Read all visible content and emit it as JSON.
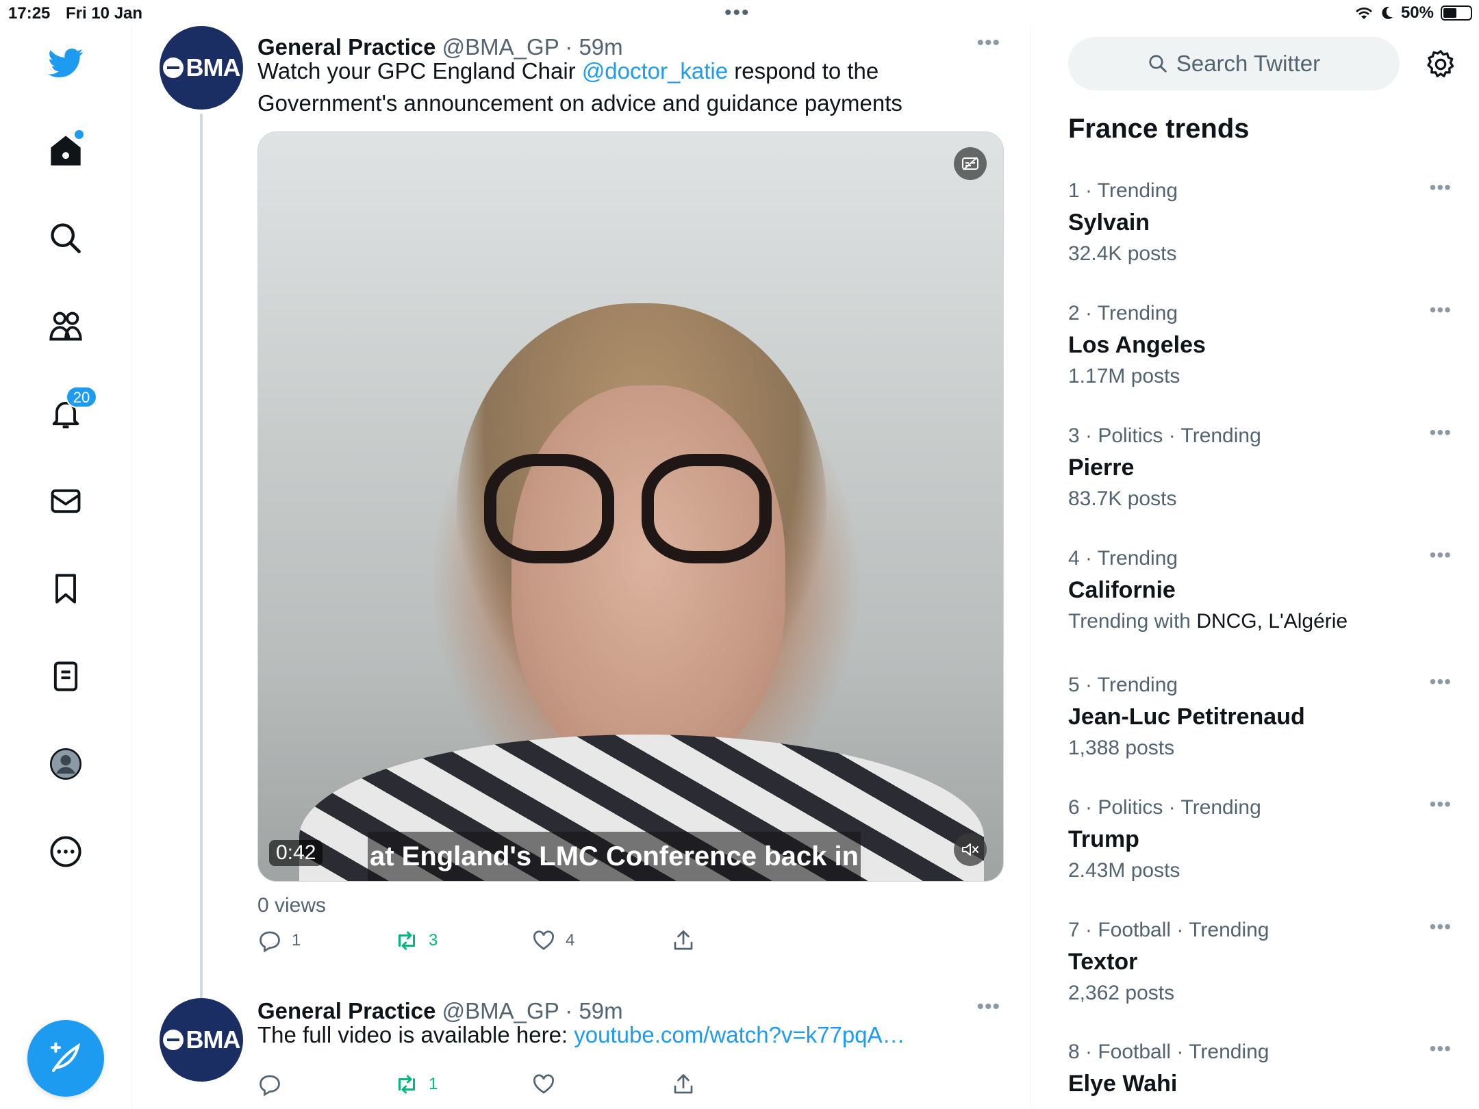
{
  "status_bar": {
    "time": "17:25",
    "date": "Fri 10 Jan",
    "battery": "50%",
    "battery_level": 0.5
  },
  "nav": {
    "notifications_count": "20"
  },
  "tweets": [
    {
      "name": "General Practice",
      "meta": "@BMA_GP · 59m",
      "avatar_text": "BMA",
      "text_before": "Watch your GPC England Chair ",
      "mention": "@doctor_katie",
      "text_after": " respond to the Government's announcement on advice and guidance payments",
      "video": {
        "duration": "0:42",
        "subtitle": "at England's LMC Conference back in"
      },
      "views": "0 views",
      "replies": "1",
      "retweets": "3",
      "likes": "4"
    },
    {
      "name": "General Practice",
      "meta": "@BMA_GP · 59m",
      "avatar_text": "BMA",
      "text_before": "The full video is available here: ",
      "link": "youtube.com/watch?v=k77pqA…",
      "replies": "",
      "retweets": "1",
      "likes": ""
    }
  ],
  "sidebar": {
    "search_placeholder": "Search Twitter",
    "trends_title": "France trends",
    "trends": [
      {
        "context": "1 · Trending",
        "name": "Sylvain",
        "count": "32.4K posts"
      },
      {
        "context": "2 · Trending",
        "name": "Los Angeles",
        "count": "1.17M posts"
      },
      {
        "context": "3 · Politics · Trending",
        "name": "Pierre",
        "count": "83.7K posts"
      },
      {
        "context": "4 · Trending",
        "name": "Californie",
        "count_prefix": "Trending with ",
        "count": "DNCG, L'Algérie"
      },
      {
        "context": "5 · Trending",
        "name": "Jean-Luc Petitrenaud",
        "count": "1,388 posts"
      },
      {
        "context": "6 · Politics · Trending",
        "name": "Trump",
        "count": "2.43M posts"
      },
      {
        "context": "7 · Football · Trending",
        "name": "Textor",
        "count": "2,362 posts"
      },
      {
        "context": "8 · Football · Trending",
        "name": "Elye Wahi",
        "count": ""
      }
    ]
  },
  "colors": {
    "accent": "#1d9bf0",
    "retweet": "#00ba7c",
    "text": "#0f1419",
    "muted": "#536471",
    "bma_navy": "#1b2e63"
  }
}
